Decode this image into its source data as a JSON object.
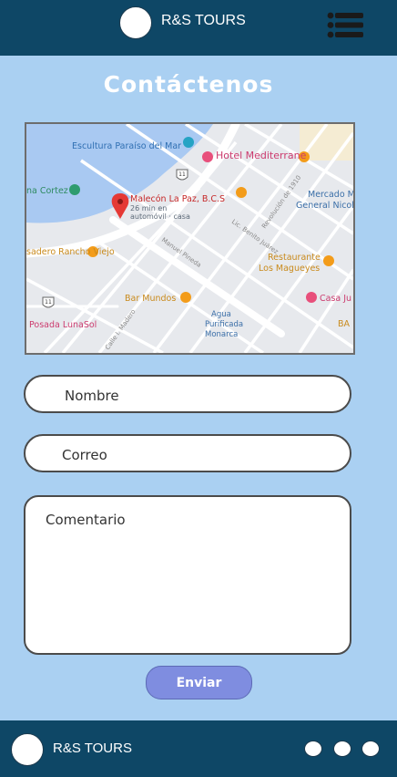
{
  "header": {
    "brand": "R&S TOURS"
  },
  "page": {
    "title": "Contáctenos"
  },
  "map": {
    "labels": {
      "escultura": "Escultura Paraíso del Mar",
      "hotel": "Hotel Mediterrane",
      "mercado1": "Mercado M",
      "mercado2": "General Nicol",
      "corte": "na Cortez",
      "malecon": "Malecón La Paz, B.C.S",
      "time1": "26 min en",
      "time2": "automóvil · casa",
      "rancho": "sadero Rancho Viejo",
      "restaurante1": "Restaurante",
      "restaurante2": "Los Magueyes",
      "bar": "Bar Mundos",
      "agua1": "Agua",
      "agua2": "Purificada",
      "agua3": "Monarca",
      "posada": "Posada LunaSol",
      "casa": "Casa Ju",
      "ban": "BA",
      "street_pineda": "Manuel Pineda",
      "street_juarez": "Lic. Benito Juárez",
      "street_revolucion": "Revolución de 1910",
      "street_madero": "Calle I. Madero",
      "route": "11"
    }
  },
  "form": {
    "name_placeholder": "Nombre",
    "email_placeholder": "Correo",
    "comment_placeholder": "Comentario",
    "submit_label": "Enviar"
  },
  "footer": {
    "brand": "R&S TOURS"
  },
  "colors": {
    "background": "#aad0f2",
    "bar": "#0e4766",
    "button": "#7f8de0"
  }
}
